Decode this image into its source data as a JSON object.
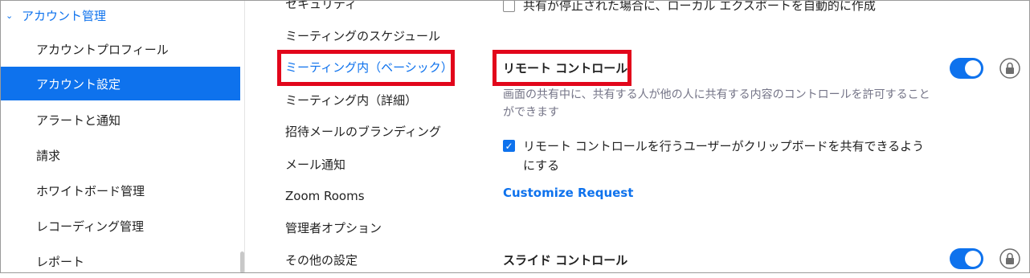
{
  "sidebar": {
    "section_label": "アカウント管理",
    "items": [
      {
        "label": "アカウントプロフィール"
      },
      {
        "label": "アカウント設定"
      },
      {
        "label": "アラートと通知"
      },
      {
        "label": "請求"
      },
      {
        "label": "ホワイトボード管理"
      },
      {
        "label": "レコーディング管理"
      },
      {
        "label": "レポート"
      }
    ],
    "active_index": 1
  },
  "subnav": {
    "items": [
      {
        "label": "セキュリティ"
      },
      {
        "label": "ミーティングのスケジュール"
      },
      {
        "label": "ミーティング内（ベーシック）"
      },
      {
        "label": "ミーティング内（詳細）"
      },
      {
        "label": "招待メールのブランディング"
      },
      {
        "label": "メール通知"
      },
      {
        "label": "Zoom Rooms"
      },
      {
        "label": "管理者オプション"
      },
      {
        "label": "その他の設定"
      }
    ],
    "active_index": 2
  },
  "content": {
    "top_checkbox_label": "共有が停止された場合に、ローカル エクスポートを自動的に作成",
    "remote_control": {
      "title": "リモート コントロール",
      "description": "画面の共有中に、共有する人が他の人に共有する内容のコントロールを許可することができます",
      "clipboard_option": "リモート コントロールを行うユーザーがクリップボードを共有できるようにする",
      "clipboard_checked": true,
      "customize_link": "Customize Request",
      "enabled": true
    },
    "slide_control": {
      "title": "スライド コントロール",
      "enabled": true
    }
  },
  "colors": {
    "accent": "#0e72ed",
    "highlight": "#e2061b"
  }
}
